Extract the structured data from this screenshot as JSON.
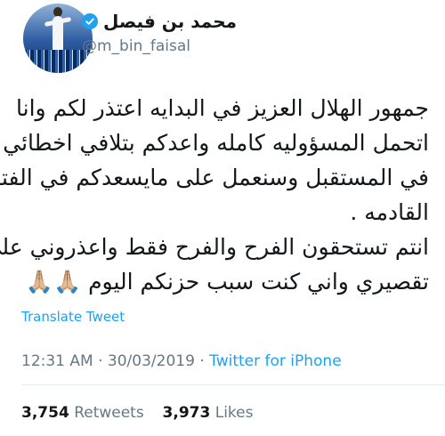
{
  "author": {
    "display_name": "محمد بن فيصل",
    "handle": "@m_bin_faisal",
    "verified_icon": "verified-badge-icon",
    "verified_color": "#1da1f2"
  },
  "tweet": {
    "lines": [
      "جمهور الهلال العزيز في البدايه اعتذر لكم وانا",
      "اتحمل المسؤوليه كامله واعدكم بتلافي اخطائي",
      "في المستقبل وسنعمل على مايسعدكم في الفتره",
      "القادمه .",
      "انتم تستحقون الفرح والفرح فقط واعذروني على",
      "تقصيري واني كنت سبب حزنكم اليوم 🙏🏼🙏🏼"
    ],
    "translate_label": "Translate Tweet",
    "time": "12:31 AM",
    "separator": "·",
    "date": "30/03/2019",
    "source": "Twitter for iPhone"
  },
  "stats": {
    "retweets_count": "3,754",
    "retweets_label": "Retweets",
    "likes_count": "3,973",
    "likes_label": "Likes"
  },
  "colors": {
    "link": "#1da1f2",
    "muted": "#657786",
    "text": "#14171a"
  }
}
